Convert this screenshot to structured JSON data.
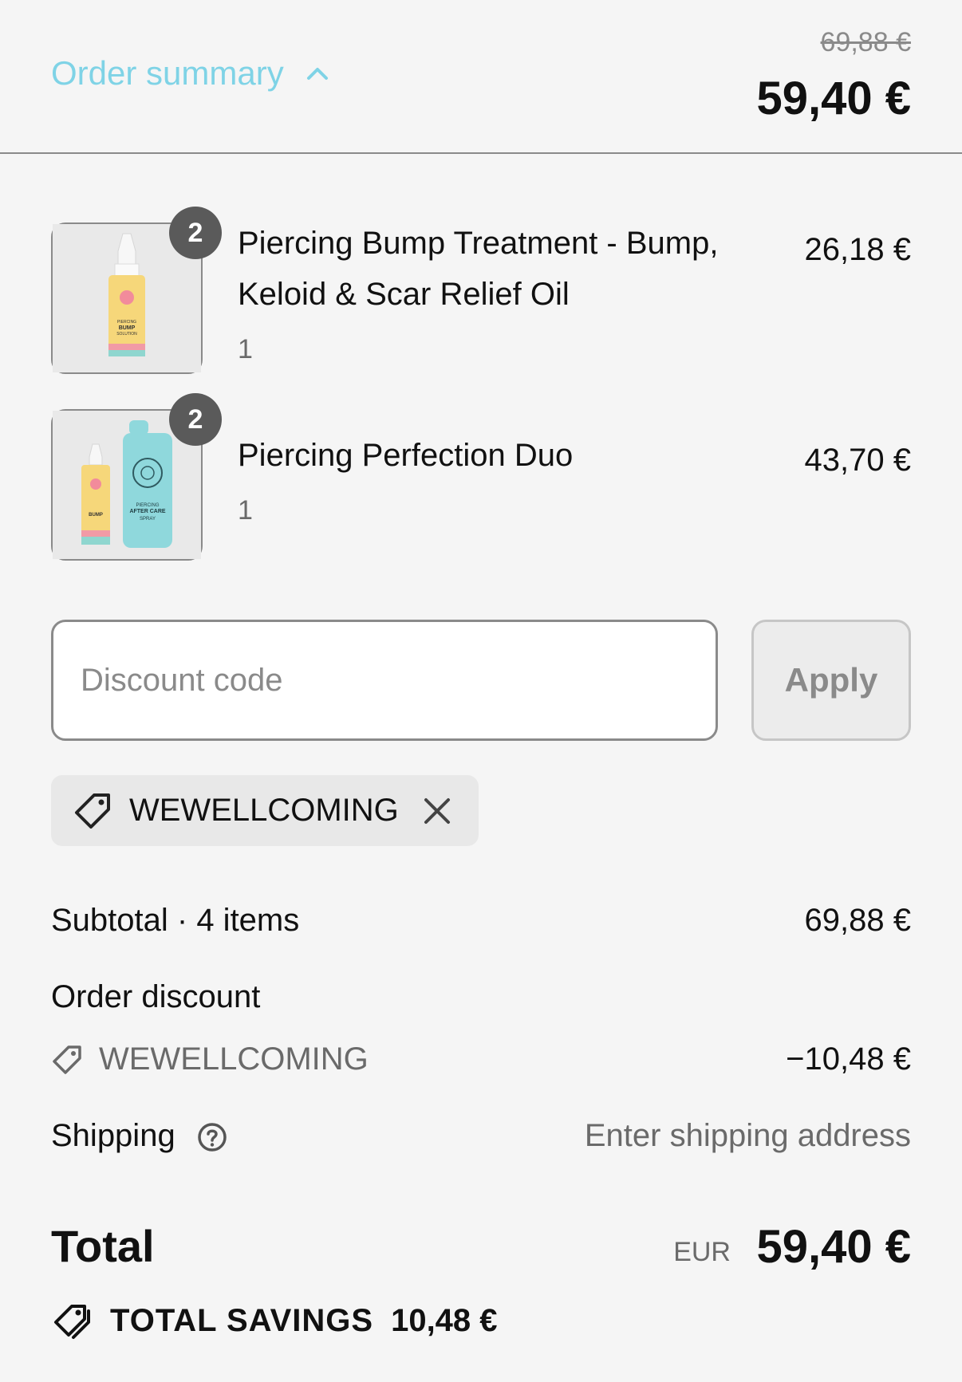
{
  "header": {
    "toggle_label": "Order summary",
    "compare_at_total": "69,88 €",
    "total": "59,40 €",
    "accent_color": "#7fd3e6"
  },
  "line_items": [
    {
      "title_line1": "Piercing Bump Treatment - Bump,",
      "title_line2": "Keloid & Scar Relief Oil",
      "quantity": "1",
      "badge": "2",
      "price": "26,18 €",
      "image_icon": "serum-bottle-image",
      "bottle_label": "PIERCING BUMP SOLUTION"
    },
    {
      "title_line1": "Piercing Perfection Duo",
      "quantity": "1",
      "badge": "2",
      "price": "43,70 €",
      "image_icon": "bottle-and-spray-image",
      "spray_label": "PIERCING AFTER CARE SPRAY"
    }
  ],
  "discount": {
    "placeholder": "Discount code",
    "apply_label": "Apply",
    "applied_code": "WEWELLCOMING"
  },
  "totals": {
    "subtotal_label": "Subtotal · 4 items",
    "subtotal_value": "69,88 €",
    "order_discount_label": "Order discount",
    "order_discount_code": "WEWELLCOMING",
    "order_discount_value": "−10,48 €",
    "shipping_label": "Shipping",
    "shipping_value": "Enter shipping address",
    "total_label": "Total",
    "currency": "EUR",
    "total_value": "59,40 €",
    "savings_label": "TOTAL SAVINGS",
    "savings_value": "10,48 €"
  }
}
